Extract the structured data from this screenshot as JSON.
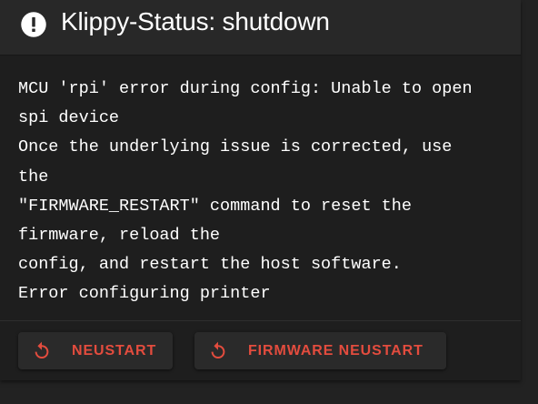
{
  "dialog": {
    "title": "Klippy-Status: shutdown",
    "status_icon": "alert-circle-icon",
    "message_lines": [
      "MCU 'rpi' error during config: Unable to open",
      "spi device",
      "Once the underlying issue is corrected, use",
      "the",
      "\"FIRMWARE_RESTART\" command to reset the",
      "firmware, reload the",
      "config, and restart the host software.",
      "Error configuring printer"
    ]
  },
  "actions": {
    "restart": {
      "label": "NEUSTART",
      "icon": "restart-icon"
    },
    "firmware_restart": {
      "label": "FIRMWARE NEUSTART",
      "icon": "restart-icon"
    }
  },
  "colors": {
    "accent": "#e34c3e",
    "background": "#1e1e1e",
    "header": "#282828",
    "text": "#ffffff"
  }
}
